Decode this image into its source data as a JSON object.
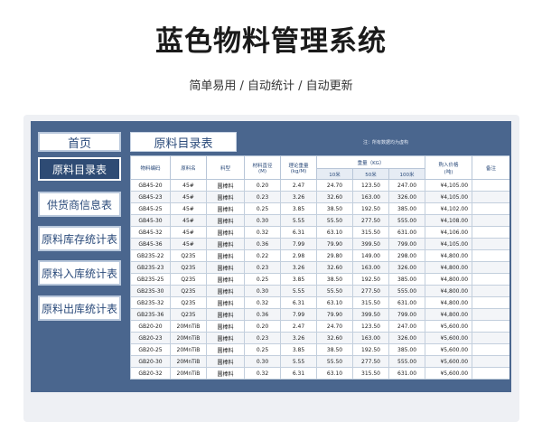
{
  "header": {
    "title": "蓝色物料管理系统",
    "subtitle": "简单易用  /  自动统计  /  自动更新"
  },
  "sidebar": {
    "home": "首页",
    "items": [
      {
        "label": "原料目录表",
        "active": true
      },
      {
        "label": "供货商信息表",
        "active": false
      },
      {
        "label": "原料库存统计表",
        "active": false
      },
      {
        "label": "原料入库统计表",
        "active": false
      },
      {
        "label": "原料出库统计表",
        "active": false
      }
    ]
  },
  "main": {
    "section_title": "原料目录表",
    "note": "注：所有数据均为虚构",
    "columns": {
      "code": "物料编码",
      "name": "原料名",
      "type": "料型",
      "diameter": "材料直径\n(M)",
      "weight_theory": "理论重量\n(kg/M)",
      "weight_group": "重量（KG）",
      "w10": "10米",
      "w50": "50米",
      "w100": "100米",
      "price": "购入价格\n(吨)",
      "remark": "备注"
    },
    "rows": [
      [
        "GB45-20",
        "45#",
        "圆棒料",
        "0.20",
        "2.47",
        "24.70",
        "123.50",
        "247.00",
        "¥4,105.00",
        ""
      ],
      [
        "GB45-23",
        "45#",
        "圆棒料",
        "0.23",
        "3.26",
        "32.60",
        "163.00",
        "326.00",
        "¥4,105.00",
        ""
      ],
      [
        "GB45-25",
        "45#",
        "圆棒料",
        "0.25",
        "3.85",
        "38.50",
        "192.50",
        "385.00",
        "¥4,102.00",
        ""
      ],
      [
        "GB45-30",
        "45#",
        "圆棒料",
        "0.30",
        "5.55",
        "55.50",
        "277.50",
        "555.00",
        "¥4,108.00",
        ""
      ],
      [
        "GB45-32",
        "45#",
        "圆棒料",
        "0.32",
        "6.31",
        "63.10",
        "315.50",
        "631.00",
        "¥4,106.00",
        ""
      ],
      [
        "GB45-36",
        "45#",
        "圆棒料",
        "0.36",
        "7.99",
        "79.90",
        "399.50",
        "799.00",
        "¥4,105.00",
        ""
      ],
      [
        "GB235-22",
        "Q235",
        "圆棒料",
        "0.22",
        "2.98",
        "29.80",
        "149.00",
        "298.00",
        "¥4,800.00",
        ""
      ],
      [
        "GB235-23",
        "Q235",
        "圆棒料",
        "0.23",
        "3.26",
        "32.60",
        "163.00",
        "326.00",
        "¥4,800.00",
        ""
      ],
      [
        "GB235-25",
        "Q235",
        "圆棒料",
        "0.25",
        "3.85",
        "38.50",
        "192.50",
        "385.00",
        "¥4,800.00",
        ""
      ],
      [
        "GB235-30",
        "Q235",
        "圆棒料",
        "0.30",
        "5.55",
        "55.50",
        "277.50",
        "555.00",
        "¥4,800.00",
        ""
      ],
      [
        "GB235-32",
        "Q235",
        "圆棒料",
        "0.32",
        "6.31",
        "63.10",
        "315.50",
        "631.00",
        "¥4,800.00",
        ""
      ],
      [
        "GB235-36",
        "Q235",
        "圆棒料",
        "0.36",
        "7.99",
        "79.90",
        "399.50",
        "799.00",
        "¥4,800.00",
        ""
      ],
      [
        "GB20-20",
        "20MnTiB",
        "圆棒料",
        "0.20",
        "2.47",
        "24.70",
        "123.50",
        "247.00",
        "¥5,600.00",
        ""
      ],
      [
        "GB20-23",
        "20MnTiB",
        "圆棒料",
        "0.23",
        "3.26",
        "32.60",
        "163.00",
        "326.00",
        "¥5,600.00",
        ""
      ],
      [
        "GB20-25",
        "20MnTiB",
        "圆棒料",
        "0.25",
        "3.85",
        "38.50",
        "192.50",
        "385.00",
        "¥5,600.00",
        ""
      ],
      [
        "GB20-30",
        "20MnTiB",
        "圆棒料",
        "0.30",
        "5.55",
        "55.50",
        "277.50",
        "555.00",
        "¥5,600.00",
        ""
      ],
      [
        "GB20-32",
        "20MnTiB",
        "圆棒料",
        "0.32",
        "6.31",
        "63.10",
        "315.50",
        "631.00",
        "¥5,600.00",
        ""
      ]
    ]
  },
  "colors": {
    "panel": "#4a668e",
    "active_nav": "#2e4b74",
    "accent_text": "#2a4a7a"
  }
}
